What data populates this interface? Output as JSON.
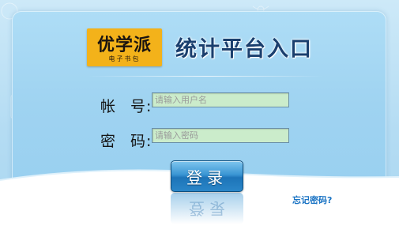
{
  "logo": {
    "main_text": "优学派",
    "sub_text": "电子书包"
  },
  "page_title": "统计平台入口",
  "form": {
    "account_label_a": "帐",
    "account_label_b": "号:",
    "account_placeholder": "请输入用户名",
    "password_label_a": "密",
    "password_label_b": "码:",
    "password_placeholder": "请输入密码"
  },
  "login_button_label": "登录",
  "forgot_password_label": "忘记密码?",
  "colors": {
    "logo_bg": "#f3b21a",
    "title": "#1a3f6e",
    "input_bg": "#cbeccb",
    "button": "#2a86c8",
    "link": "#1b74c4"
  }
}
